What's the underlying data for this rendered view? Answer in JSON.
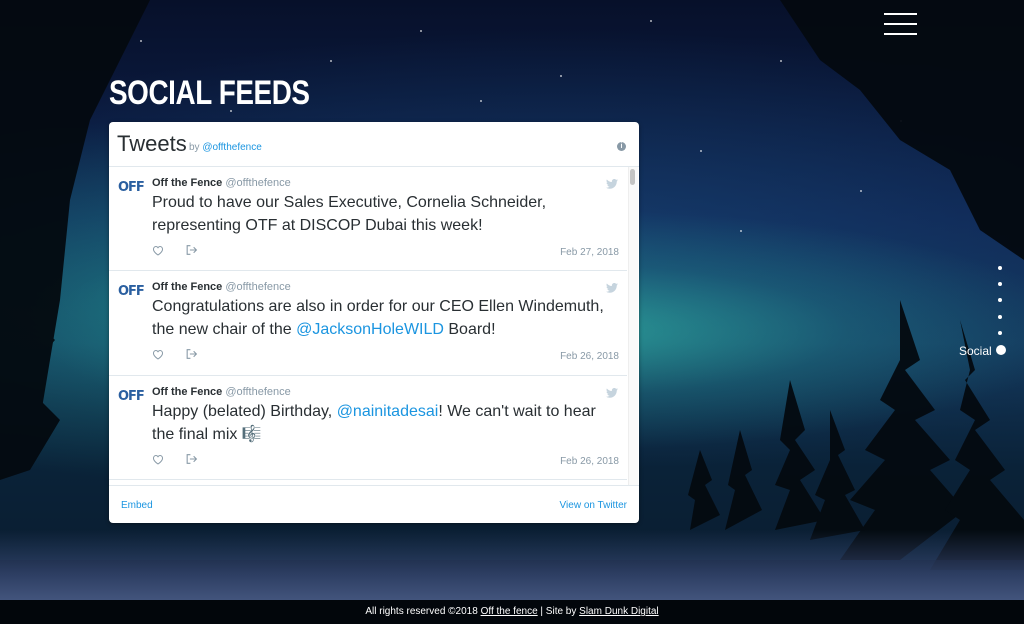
{
  "page": {
    "title": "SOCIAL FEEDS"
  },
  "widget": {
    "title": "Tweets",
    "by_prefix": "by",
    "by_handle": "@offthefence",
    "tweets": [
      {
        "author": "Off the Fence",
        "handle": "@offthefence",
        "avatar": "OFF",
        "text_parts": [
          "Proud to have our Sales Executive, Cornelia Schneider, representing OTF at DISCOP Dubai this week!"
        ],
        "date": "Feb 27, 2018"
      },
      {
        "author": "Off the Fence",
        "handle": "@offthefence",
        "avatar": "OFF",
        "text_before": "Congratulations are also in order for our CEO Ellen Windemuth, the new chair of the ",
        "mention": "@JacksonHoleWILD",
        "text_after": " Board!",
        "date": "Feb 26, 2018"
      },
      {
        "author": "Off the Fence",
        "handle": "@offthefence",
        "avatar": "OFF",
        "text_before": "Happy (belated) Birthday, ",
        "mention": "@nainitadesai",
        "text_after": "! We can't wait to hear the final mix ",
        "emoji": "🎼",
        "date": "Feb 26, 2018"
      }
    ],
    "footer": {
      "embed": "Embed",
      "view": "View on Twitter"
    }
  },
  "section_nav": {
    "active_label": "Social",
    "dot_count": 5
  },
  "footer": {
    "text_prefix": "All rights reserved ©2018",
    "link1": "Off the fence",
    "sep": "| Site by",
    "link2": "Slam Dunk Digital"
  },
  "colors": {
    "link": "#1b95e0",
    "text": "#292f33",
    "muted": "#8899a6"
  },
  "icons": [
    "menu-icon",
    "info-icon",
    "twitter-bird-icon",
    "heart-icon",
    "share-icon"
  ]
}
